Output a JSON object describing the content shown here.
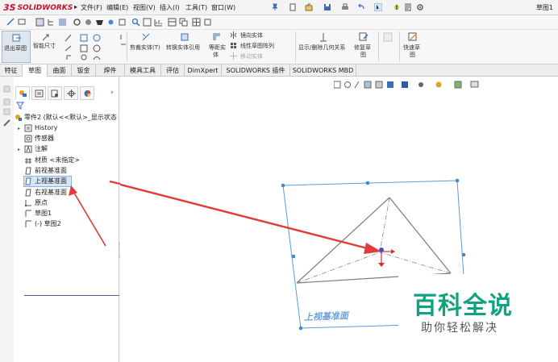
{
  "app": {
    "logo_mark": "3S",
    "logo_text": "SOLIDWORKS",
    "doc_title": "草图1"
  },
  "menu": [
    {
      "label": "文件(F)"
    },
    {
      "label": "编辑(E)"
    },
    {
      "label": "视图(V)"
    },
    {
      "label": "插入(I)"
    },
    {
      "label": "工具(T)"
    },
    {
      "label": "窗口(W)"
    }
  ],
  "command_manager": {
    "exit_sketch": "退出草图",
    "smart_dimension": "智能尺寸",
    "trim_entities": "剪裁实体(T)",
    "convert_entities": "转换实体引用",
    "offset_entities_1": "等距实",
    "offset_entities_2": "体",
    "mirror_entities": "镜向实体",
    "linear_pattern": "线性草图阵列",
    "move_entities": "移动实体",
    "display_relations": "显示/删除几何关系",
    "repair_sketch_1": "修复草",
    "repair_sketch_2": "图",
    "rapid_sketch_1": "快速草",
    "rapid_sketch_2": "图"
  },
  "tabs": [
    {
      "label": "特征"
    },
    {
      "label": "草图",
      "active": true
    },
    {
      "label": "曲面"
    },
    {
      "label": "钣金"
    },
    {
      "label": "焊件"
    },
    {
      "label": "模具工具"
    },
    {
      "label": "评估"
    },
    {
      "label": "DimXpert"
    },
    {
      "label": "SOLIDWORKS 插件"
    },
    {
      "label": "SOLIDWORKS MBD"
    }
  ],
  "feature_tree": {
    "root": "零件2 (默认<<默认>_显示状态",
    "items": [
      {
        "label": "History",
        "icon": "history-icon"
      },
      {
        "label": "传感器",
        "icon": "sensor-icon"
      },
      {
        "label": "注解",
        "icon": "annotation-icon"
      },
      {
        "label": "材质 <未指定>",
        "icon": "material-icon"
      },
      {
        "label": "前视基准面",
        "icon": "plane-icon"
      },
      {
        "label": "上视基准面",
        "icon": "plane-icon",
        "selected": true
      },
      {
        "label": "右视基准面",
        "icon": "plane-icon"
      },
      {
        "label": "原点",
        "icon": "origin-icon"
      },
      {
        "label": "草图1",
        "icon": "sketch-icon"
      },
      {
        "label": "(-) 草图2",
        "icon": "sketch-icon"
      }
    ]
  },
  "viewport": {
    "plane_label": "上视基准面"
  },
  "watermark": {
    "main": "百科全说",
    "sub": "助你轻松解决"
  },
  "colors": {
    "plane_edge": "#5b9bd5",
    "sketch_line": "#7a7a7a",
    "annotation_arrow": "#e03a3a",
    "watermark_green": "#10a37f"
  }
}
